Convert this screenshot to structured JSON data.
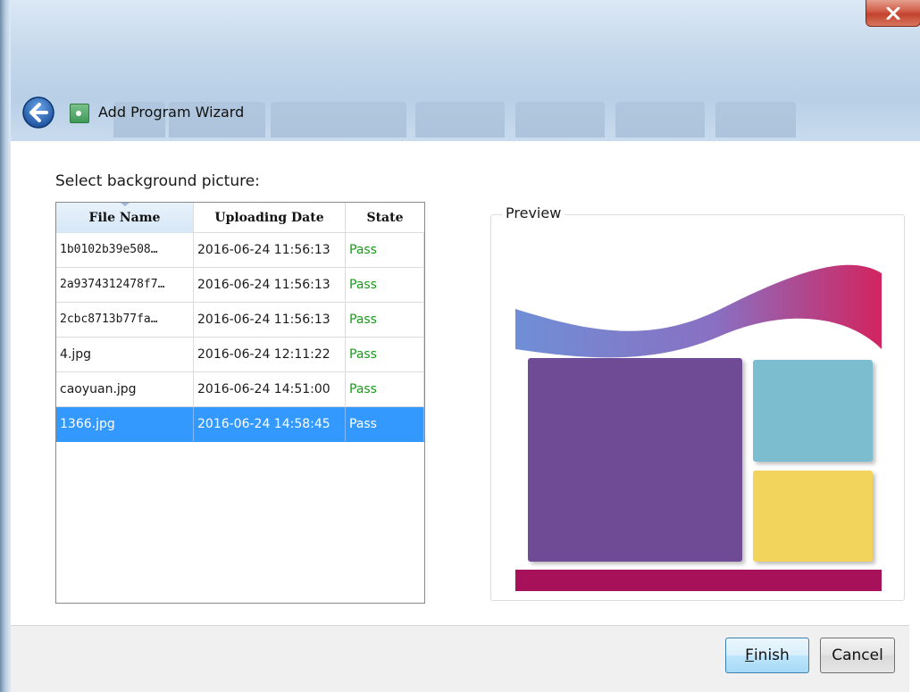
{
  "window": {
    "title": "Add Program Wizard",
    "close_glyph": "x",
    "ghost_tabs": [
      "",
      "",
      "",
      "",
      "",
      "",
      "",
      ""
    ]
  },
  "icons": {
    "back": "back-arrow-icon",
    "app": "app-green-icon",
    "close": "close-x-icon"
  },
  "main": {
    "select_label": "Select background picture:",
    "table": {
      "columns": [
        "File Name",
        "Uploading Date",
        "State"
      ],
      "rows": [
        {
          "file_name": "1b0102b39e508…",
          "date": "2016-06-24 11:56:13",
          "state": "Pass",
          "selected": false
        },
        {
          "file_name": "2a9374312478f7…",
          "date": "2016-06-24 11:56:13",
          "state": "Pass",
          "selected": false
        },
        {
          "file_name": "2cbc8713b77fa…",
          "date": "2016-06-24 11:56:13",
          "state": "Pass",
          "selected": false
        },
        {
          "file_name": "4.jpg",
          "date": "2016-06-24 12:11:22",
          "state": "Pass",
          "selected": false
        },
        {
          "file_name": "caoyuan.jpg",
          "date": "2016-06-24 14:51:00",
          "state": "Pass",
          "selected": false
        },
        {
          "file_name": "1366.jpg",
          "date": "2016-06-24 14:58:45",
          "state": "Pass",
          "selected": true
        }
      ]
    },
    "preview": {
      "legend": "Preview",
      "colors": {
        "wave_left": "#6f8fd6",
        "wave_right": "#d2245f",
        "big_tile": "#6f4c95",
        "top_right_tile": "#7dbdd0",
        "bottom_right_tile": "#f2d45d",
        "bottom_bar": "#a6115a"
      }
    }
  },
  "footer": {
    "finish_mnemonic": "F",
    "finish_rest": "inish",
    "cancel": "Cancel"
  },
  "colors": {
    "selection": "#3399ff",
    "pass_text": "#1a9a1a"
  }
}
